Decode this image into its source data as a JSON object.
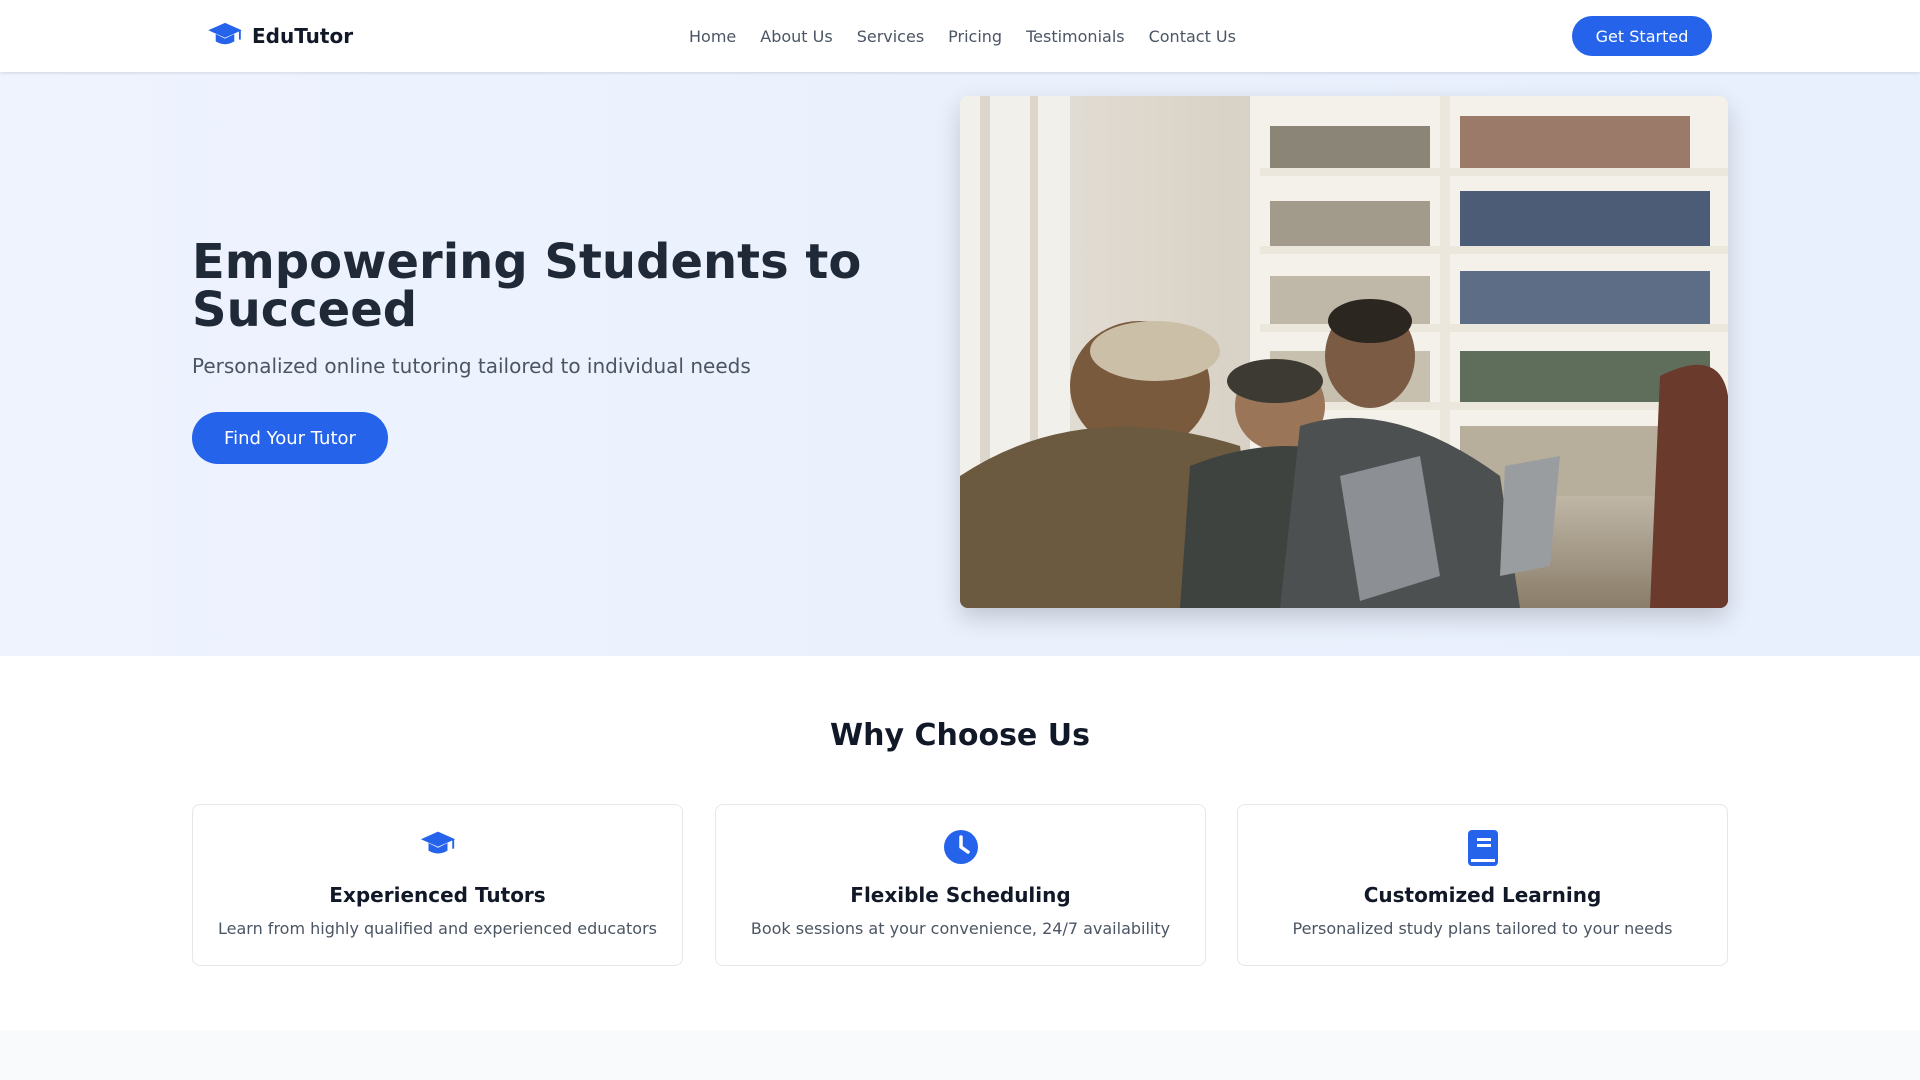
{
  "nav": {
    "brand": "EduTutor",
    "links": [
      "Home",
      "About Us",
      "Services",
      "Pricing",
      "Testimonials",
      "Contact Us"
    ],
    "cta": "Get Started"
  },
  "hero": {
    "title": "Empowering Students to Succeed",
    "subtitle": "Personalized online tutoring tailored to individual needs",
    "button": "Find Your Tutor",
    "image_icon": "hero-photo"
  },
  "features": {
    "title": "Why Choose Us",
    "cards": [
      {
        "icon": "graduation-cap-icon",
        "title": "Experienced Tutors",
        "desc": "Learn from highly qualified and experienced educators"
      },
      {
        "icon": "clock-icon",
        "title": "Flexible Scheduling",
        "desc": "Book sessions at your convenience, 24/7 availability"
      },
      {
        "icon": "book-icon",
        "title": "Customized Learning",
        "desc": "Personalized study plans tailored to your needs"
      }
    ]
  },
  "colors": {
    "accent": "#2563eb",
    "hero_bg": "#eaf1fd",
    "text_dark": "#1f2937",
    "text_muted": "#4b5563"
  }
}
